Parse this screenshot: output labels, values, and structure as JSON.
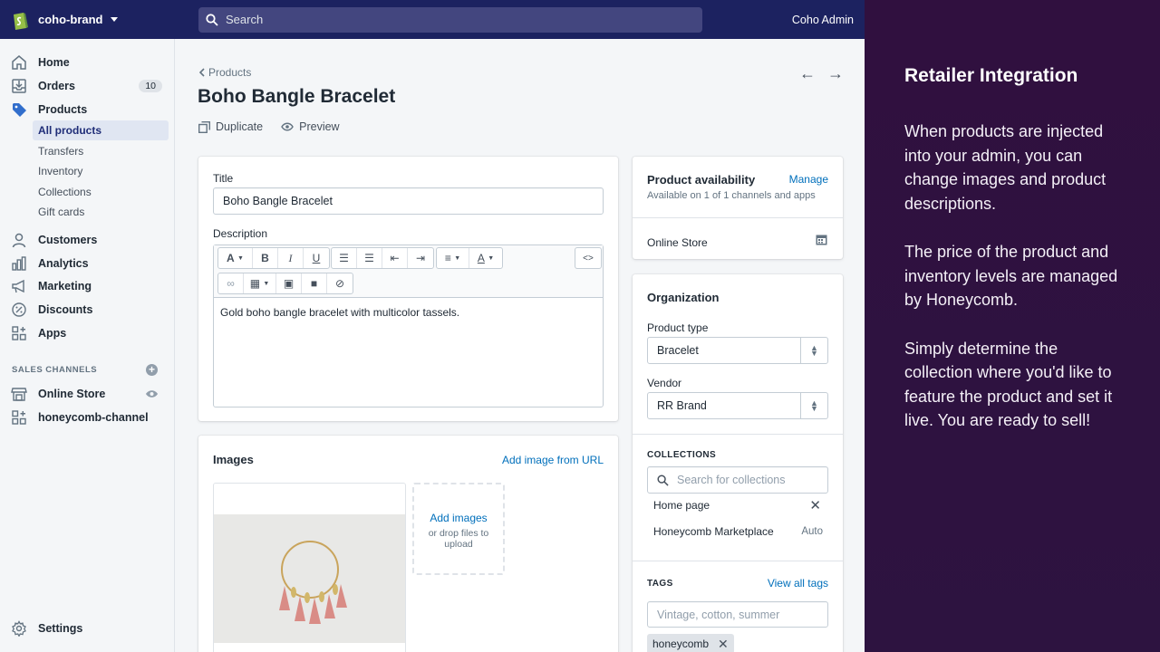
{
  "topbar": {
    "store_name": "coho-brand",
    "search_placeholder": "Search",
    "user": "Coho Admin"
  },
  "sidebar": {
    "items": [
      {
        "label": "Home",
        "icon": "home-icon"
      },
      {
        "label": "Orders",
        "icon": "orders-icon",
        "badge": "10"
      },
      {
        "label": "Products",
        "icon": "tag-icon"
      },
      {
        "label": "Customers",
        "icon": "person-icon"
      },
      {
        "label": "Analytics",
        "icon": "bar-chart-icon"
      },
      {
        "label": "Marketing",
        "icon": "megaphone-icon"
      },
      {
        "label": "Discounts",
        "icon": "discount-icon"
      },
      {
        "label": "Apps",
        "icon": "apps-icon"
      }
    ],
    "product_subitems": [
      "All products",
      "Transfers",
      "Inventory",
      "Collections",
      "Gift cards"
    ],
    "sales_channels_heading": "SALES CHANNELS",
    "channels": [
      {
        "label": "Online Store",
        "icon": "store-icon"
      },
      {
        "label": "honeycomb-channel",
        "icon": "apps-icon"
      }
    ],
    "settings": "Settings"
  },
  "main": {
    "breadcrumb": "Products",
    "title": "Boho Bangle Bracelet",
    "actions": {
      "duplicate": "Duplicate",
      "preview": "Preview"
    },
    "title_label": "Title",
    "title_value": "Boho Bangle Bracelet",
    "description_label": "Description",
    "description_text": "Gold boho bangle bracelet with multicolor tassels.",
    "images": {
      "heading": "Images",
      "add_from_url": "Add image from URL",
      "add_images": "Add images",
      "drop_hint": "or drop files to upload"
    }
  },
  "availability": {
    "heading": "Product availability",
    "manage": "Manage",
    "subtext": "Available on 1 of 1 channels and apps",
    "channel": "Online Store"
  },
  "organization": {
    "heading": "Organization",
    "product_type_label": "Product type",
    "product_type_value": "Bracelet",
    "vendor_label": "Vendor",
    "vendor_value": "RR Brand",
    "collections_heading": "COLLECTIONS",
    "collections_placeholder": "Search for collections",
    "collections": [
      {
        "name": "Home page",
        "right": "✕"
      },
      {
        "name": "Honeycomb Marketplace",
        "right": "Auto"
      }
    ],
    "tags_heading": "TAGS",
    "view_all_tags": "View all tags",
    "tags_placeholder": "Vintage, cotton, summer",
    "tags": [
      "honeycomb"
    ]
  },
  "promo": {
    "heading": "Retailer Integration",
    "paragraphs": [
      "When products are injected into your admin, you can change images and product descriptions.",
      "The price of the product and inventory levels are managed by Honeycomb.",
      "Simply determine the collection where you'd like to feature the product and set it live. You are ready to sell!"
    ]
  },
  "colors": {
    "topbar": "#1c2260",
    "link": "#006fbb",
    "promo_bg": "#2e1443"
  }
}
